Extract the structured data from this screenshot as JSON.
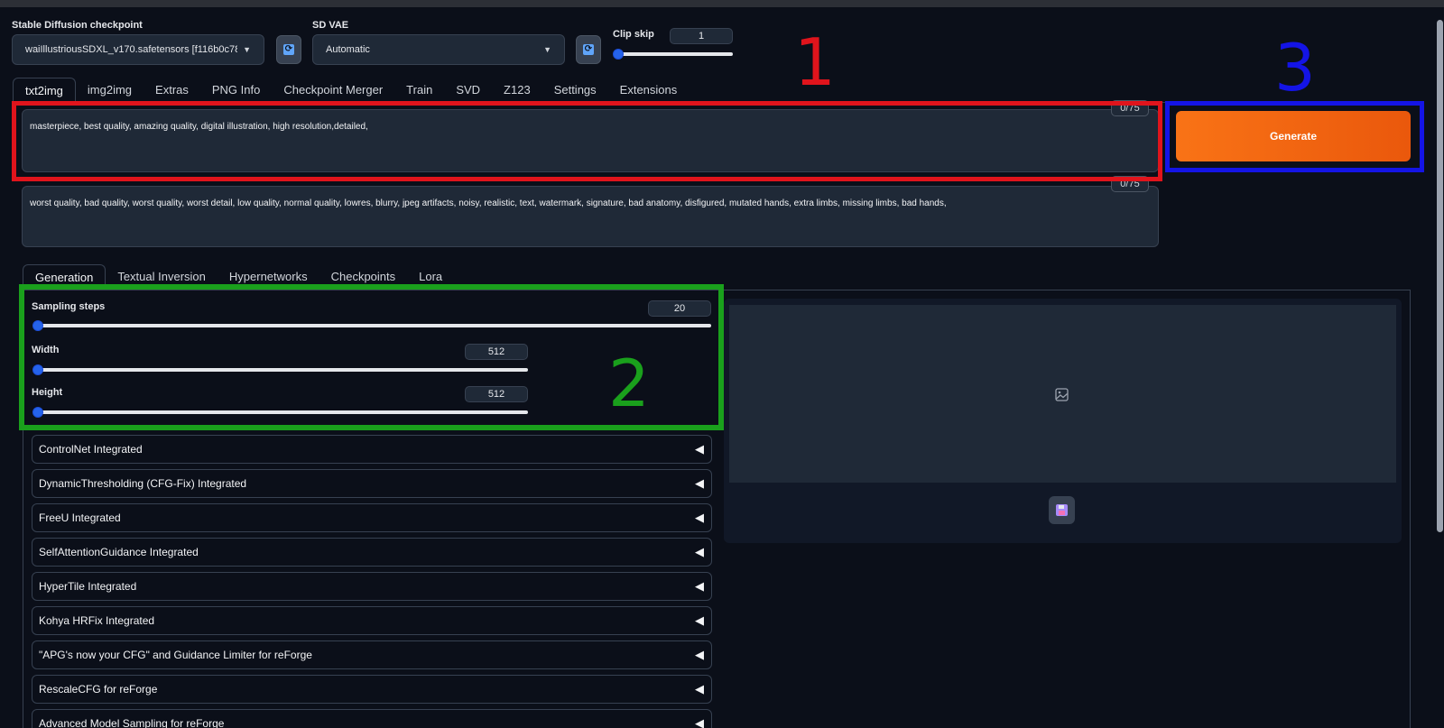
{
  "checkpoint": {
    "label": "Stable Diffusion checkpoint",
    "value": "waiIllustriousSDXL_v170.safetensors [f116b0c78"
  },
  "vae": {
    "label": "SD VAE",
    "value": "Automatic"
  },
  "clip_skip": {
    "label": "Clip skip",
    "value": "1"
  },
  "main_tabs": [
    {
      "label": "txt2img"
    },
    {
      "label": "img2img"
    },
    {
      "label": "Extras"
    },
    {
      "label": "PNG Info"
    },
    {
      "label": "Checkpoint Merger"
    },
    {
      "label": "Train"
    },
    {
      "label": "SVD"
    },
    {
      "label": "Z123"
    },
    {
      "label": "Settings"
    },
    {
      "label": "Extensions"
    }
  ],
  "prompt": {
    "text": "masterpiece, best quality, amazing quality,  digital illustration, high resolution,detailed,",
    "token_count": "0/75"
  },
  "negative_prompt": {
    "text": "worst quality, bad quality, worst quality, worst detail, low quality, normal quality, lowres, blurry, jpeg artifacts, noisy, realistic, text, watermark, signature, bad anatomy, disfigured, mutated hands, extra limbs, missing limbs, bad hands,",
    "token_count": "0/75"
  },
  "generate": {
    "label": "Generate"
  },
  "sub_tabs": [
    {
      "label": "Generation"
    },
    {
      "label": "Textual Inversion"
    },
    {
      "label": "Hypernetworks"
    },
    {
      "label": "Checkpoints"
    },
    {
      "label": "Lora"
    }
  ],
  "sampling_steps": {
    "label": "Sampling steps",
    "value": "20"
  },
  "width": {
    "label": "Width",
    "value": "512"
  },
  "height": {
    "label": "Height",
    "value": "512"
  },
  "accordions": [
    {
      "label": "ControlNet Integrated"
    },
    {
      "label": "DynamicThresholding (CFG-Fix) Integrated"
    },
    {
      "label": "FreeU Integrated"
    },
    {
      "label": "SelfAttentionGuidance Integrated"
    },
    {
      "label": "HyperTile Integrated"
    },
    {
      "label": "Kohya HRFix Integrated"
    },
    {
      "label": "\"APG's now your CFG\" and Guidance Limiter for reForge"
    },
    {
      "label": "RescaleCFG for reForge"
    },
    {
      "label": "Advanced Model Sampling for reForge"
    }
  ],
  "annotations": [
    {
      "number": "1",
      "color": "#e0141c"
    },
    {
      "number": "2",
      "color": "#1aa01c"
    },
    {
      "number": "3",
      "color": "#1414e6"
    }
  ],
  "colors": {
    "background": "#0b0f19",
    "panel": "#1f2937",
    "accent_orange": "#f97316",
    "slider_blue": "#2563eb"
  },
  "icons": {
    "image_placeholder": "image-icon",
    "save": "floppy-disk-icon",
    "refresh": "refresh-icon",
    "accordion": "triangle-left-icon"
  }
}
